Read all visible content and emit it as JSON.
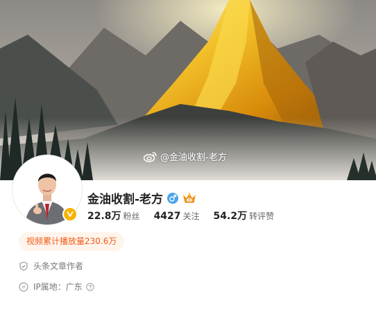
{
  "banner": {
    "watermark_text": "@金油收割-老方",
    "watermark_icon": "weibo-logo-icon"
  },
  "profile": {
    "name": "金油收割-老方",
    "gender_icon": "male-icon",
    "badge_icon": "crown-icon",
    "verified_icon": "verified-v-badge",
    "stats": [
      {
        "value": "22.8万",
        "label": "粉丝"
      },
      {
        "value": "4427",
        "label": "关注"
      },
      {
        "value": "54.2万",
        "label": "转评赞"
      }
    ],
    "video_tag": "视频累计播放量230.6万",
    "info": [
      {
        "icon": "shield-icon",
        "text": "头条文章作者"
      },
      {
        "icon": "ip-icon",
        "text": "IP属地：广东"
      }
    ]
  },
  "colors": {
    "accent_orange": "#f25b14",
    "tag_bg": "#fff4ec",
    "verified_yellow": "#f7b500",
    "male_blue": "#4aa3ea"
  }
}
